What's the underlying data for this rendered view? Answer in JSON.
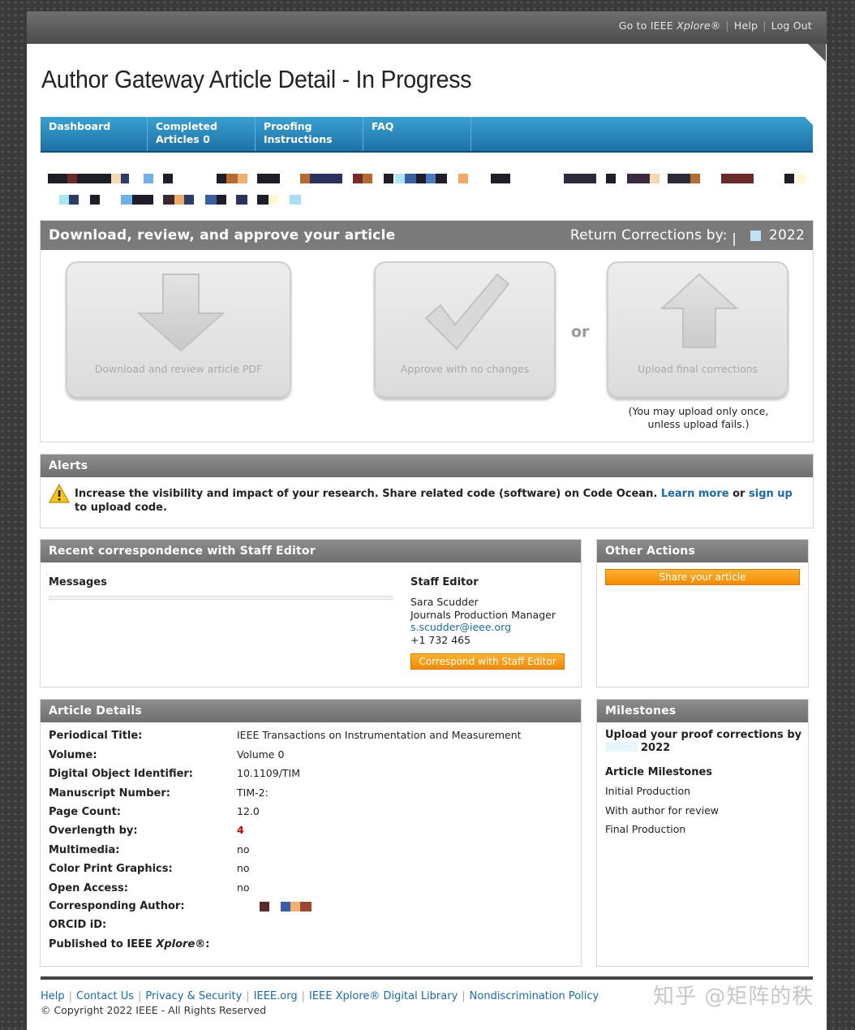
{
  "topbar": {
    "xplore_prefix": "Go to IEEE ",
    "xplore_brand": "Xplore",
    "xplore_suffix": "®",
    "help": "Help",
    "logout": "Log Out"
  },
  "page_title": "Author Gateway Article Detail - In Progress",
  "nav": [
    {
      "line1": "Dashboard",
      "line2": ""
    },
    {
      "line1": "Completed",
      "line2": "Articles 0"
    },
    {
      "line1": "Proofing",
      "line2": "Instructions"
    },
    {
      "line1": "FAQ",
      "line2": ""
    }
  ],
  "download_panel": {
    "title": "Download, review, and approve your article",
    "return_label": "Return Corrections by:",
    "return_year": "2022",
    "btn_download": "Download and review article PDF",
    "btn_approve": "Approve with no changes",
    "or": "or",
    "btn_upload": "Upload final corrections",
    "upload_note_1": "(You may upload only once,",
    "upload_note_2": "unless upload fails.)"
  },
  "alerts": {
    "title": "Alerts",
    "text": "Increase the visibility and impact of your research. Share related code (software) on Code Ocean.",
    "learn_more": "Learn more",
    "or": "or",
    "sign_up": "sign up",
    "to": "to",
    "tail": "upload code."
  },
  "correspondence": {
    "title": "Recent correspondence with Staff Editor",
    "messages_label": "Messages",
    "staff_label": "Staff Editor",
    "name": "Sara Scudder",
    "role": "Journals Production Manager",
    "email": "s.scudder@ieee.org",
    "phone": "+1 732 465",
    "button": "Correspond with Staff Editor"
  },
  "other_actions": {
    "title": "Other Actions",
    "share": "Share your article"
  },
  "article_details": {
    "title": "Article Details",
    "rows": [
      {
        "k": "Periodical Title:",
        "v": "IEEE Transactions on Instrumentation and Measurement"
      },
      {
        "k": "Volume:",
        "v": "Volume 0"
      },
      {
        "k": "Digital Object Identifier:",
        "v": "10.1109/TIM"
      },
      {
        "k": "Manuscript Number:",
        "v": "TIM-2:"
      },
      {
        "k": "Page Count:",
        "v": "12.0"
      },
      {
        "k": "Overlength by:",
        "v": "4"
      },
      {
        "k": "Multimedia:",
        "v": "no"
      },
      {
        "k": "Color Print Graphics:",
        "v": "no"
      },
      {
        "k": "Open Access:",
        "v": "no"
      },
      {
        "k": "Corresponding Author:",
        "v": ""
      },
      {
        "k": "ORCID iD:",
        "v": ""
      },
      {
        "k": "Published to IEEE ",
        "k_brand": "Xplore",
        "k_tail": "®:",
        "v": ""
      }
    ]
  },
  "milestones": {
    "title": "Milestones",
    "upload_line1": "Upload your proof corrections by",
    "upload_line2": "2022",
    "heading": "Article Milestones",
    "items": [
      "Initial Production",
      "With author for review",
      "Final Production"
    ]
  },
  "footer": {
    "links": [
      "Help",
      "Contact Us",
      "Privacy & Security",
      "IEEE.org",
      "IEEE Xplore® Digital Library",
      "Nondiscrimination Policy"
    ],
    "copyright": "© Copyright 2022 IEEE - All Rights Reserved"
  },
  "watermark": "知乎 @矩阵的秩",
  "colors": {
    "nav_blue": "#1d72a7",
    "panel_gray": "#7a7a7a",
    "orange": "#f28a00",
    "link": "#1a6aa6",
    "overlength_red": "#cc0000"
  }
}
